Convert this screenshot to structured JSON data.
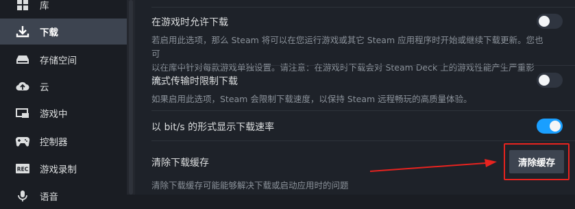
{
  "sidebar": {
    "items": [
      {
        "label": "库",
        "icon": "library-grid-icon",
        "active": false
      },
      {
        "label": "下载",
        "icon": "download-icon",
        "active": true
      },
      {
        "label": "存储空间",
        "icon": "storage-drive-icon",
        "active": false
      },
      {
        "label": "云",
        "icon": "cloud-icon",
        "active": false
      },
      {
        "label": "游戏中",
        "icon": "in-game-overlay-icon",
        "active": false
      },
      {
        "label": "控制器",
        "icon": "gamepad-icon",
        "active": false
      },
      {
        "label": "游戏录制",
        "icon": "rec-icon",
        "active": false
      },
      {
        "label": "语音",
        "icon": "voice-icon",
        "active": false
      }
    ],
    "rec_badge_text": "REC"
  },
  "settings": {
    "allow_during_game": {
      "title": "在游戏时允许下载",
      "enabled": false,
      "description_line1": "若启用此选项，那么 Steam 将可以在您运行游戏或其它 Steam 应用程序时开始或继续下载更新。您也可",
      "description_line2": "以在库中针对每款游戏单独设置。请注意：在游戏时下载会对 Steam Deck 上的游戏性能产生严重影响。"
    },
    "throttle_streaming": {
      "title": "流式传输时限制下载",
      "enabled": false,
      "description": "如果启用此选项，Steam 会限制下载速度，以保持 Steam 远程畅玩的高质量体验。"
    },
    "bits_display": {
      "title": "以 bit/s 的形式显示下载速率",
      "enabled": true
    },
    "clear_cache": {
      "title": "清除下载缓存",
      "button_label": "清除缓存",
      "description": "清除下载缓存可能能够解决下载或启动应用时的问题"
    }
  },
  "colors": {
    "toggle_on": "#1a9fff",
    "annotation_red": "#e8231f",
    "active_nav": "#3d4450"
  }
}
